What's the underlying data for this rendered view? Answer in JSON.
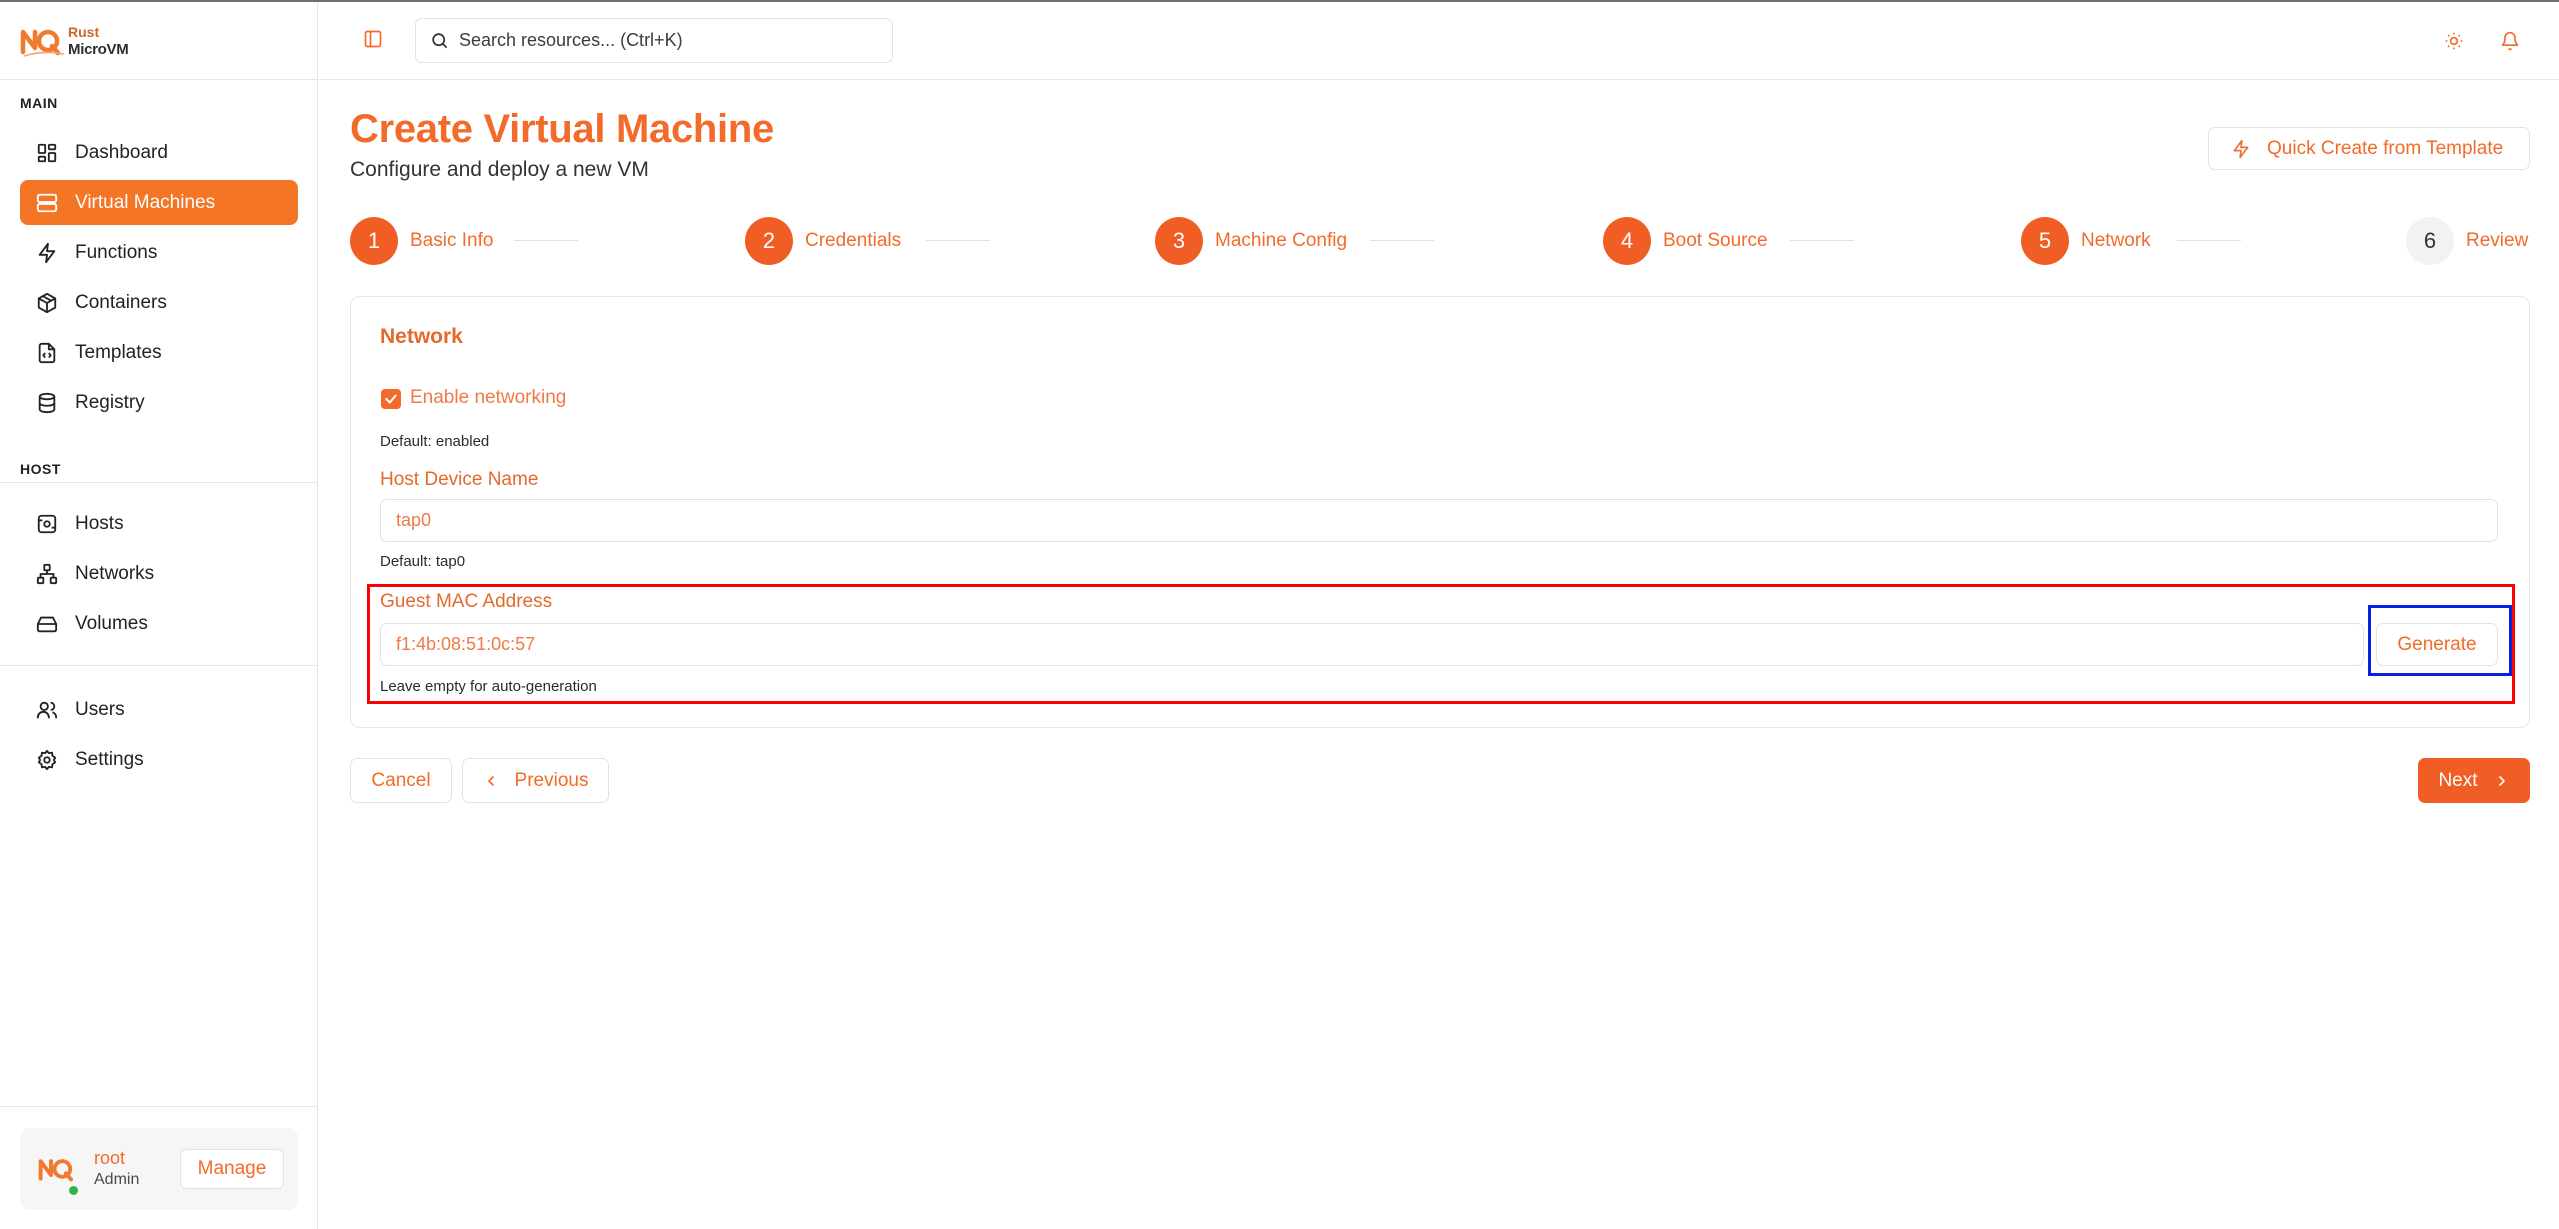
{
  "brand": {
    "line1": "Rust",
    "line2": "MicroVM"
  },
  "sidebar": {
    "sections": {
      "main": "MAIN",
      "host": "HOST"
    },
    "main_items": [
      {
        "label": "Dashboard",
        "icon": "dashboard-icon"
      },
      {
        "label": "Virtual Machines",
        "icon": "server-icon",
        "active": true
      },
      {
        "label": "Functions",
        "icon": "bolt-icon"
      },
      {
        "label": "Containers",
        "icon": "box-icon"
      },
      {
        "label": "Templates",
        "icon": "template-file-icon"
      },
      {
        "label": "Registry",
        "icon": "database-icon"
      }
    ],
    "host_items": [
      {
        "label": "Hosts",
        "icon": "host-icon"
      },
      {
        "label": "Networks",
        "icon": "network-icon"
      },
      {
        "label": "Volumes",
        "icon": "hard-drive-icon"
      }
    ],
    "bottom_items": [
      {
        "label": "Users",
        "icon": "users-icon"
      },
      {
        "label": "Settings",
        "icon": "gear-icon"
      }
    ],
    "user": {
      "name": "root",
      "role": "Admin",
      "manage_label": "Manage",
      "status_color": "#2fb34c"
    }
  },
  "header": {
    "search": {
      "placeholder": "Search resources... (Ctrl+K)"
    },
    "icons": [
      "sidebar-toggle-icon",
      "search-icon",
      "sun-icon",
      "bell-icon"
    ]
  },
  "page": {
    "title": "Create Virtual Machine",
    "subtitle": "Configure and deploy a new VM",
    "quick_create_label": "Quick Create from Template"
  },
  "steps": [
    {
      "number": "1",
      "label": "Basic Info",
      "state": "done"
    },
    {
      "number": "2",
      "label": "Credentials",
      "state": "done"
    },
    {
      "number": "3",
      "label": "Machine Config",
      "state": "done"
    },
    {
      "number": "4",
      "label": "Boot Source",
      "state": "done"
    },
    {
      "number": "5",
      "label": "Network",
      "state": "current"
    },
    {
      "number": "6",
      "label": "Review",
      "state": "pending"
    }
  ],
  "form": {
    "section_title": "Network",
    "enable_networking": {
      "label": "Enable networking",
      "checked": true,
      "help": "Default: enabled"
    },
    "host_device": {
      "label": "Host Device Name",
      "value": "tap0",
      "help": "Default: tap0"
    },
    "guest_mac": {
      "label": "Guest MAC Address",
      "value": "f1:4b:08:51:0c:57",
      "help": "Leave empty for auto-generation",
      "generate_label": "Generate"
    }
  },
  "actions": {
    "cancel": "Cancel",
    "previous": "Previous",
    "next": "Next"
  },
  "colors": {
    "accent": "#f26b2a",
    "accent_active": "#f47525",
    "highlight_red": "#ff0000",
    "highlight_blue": "#0a1fe0"
  }
}
